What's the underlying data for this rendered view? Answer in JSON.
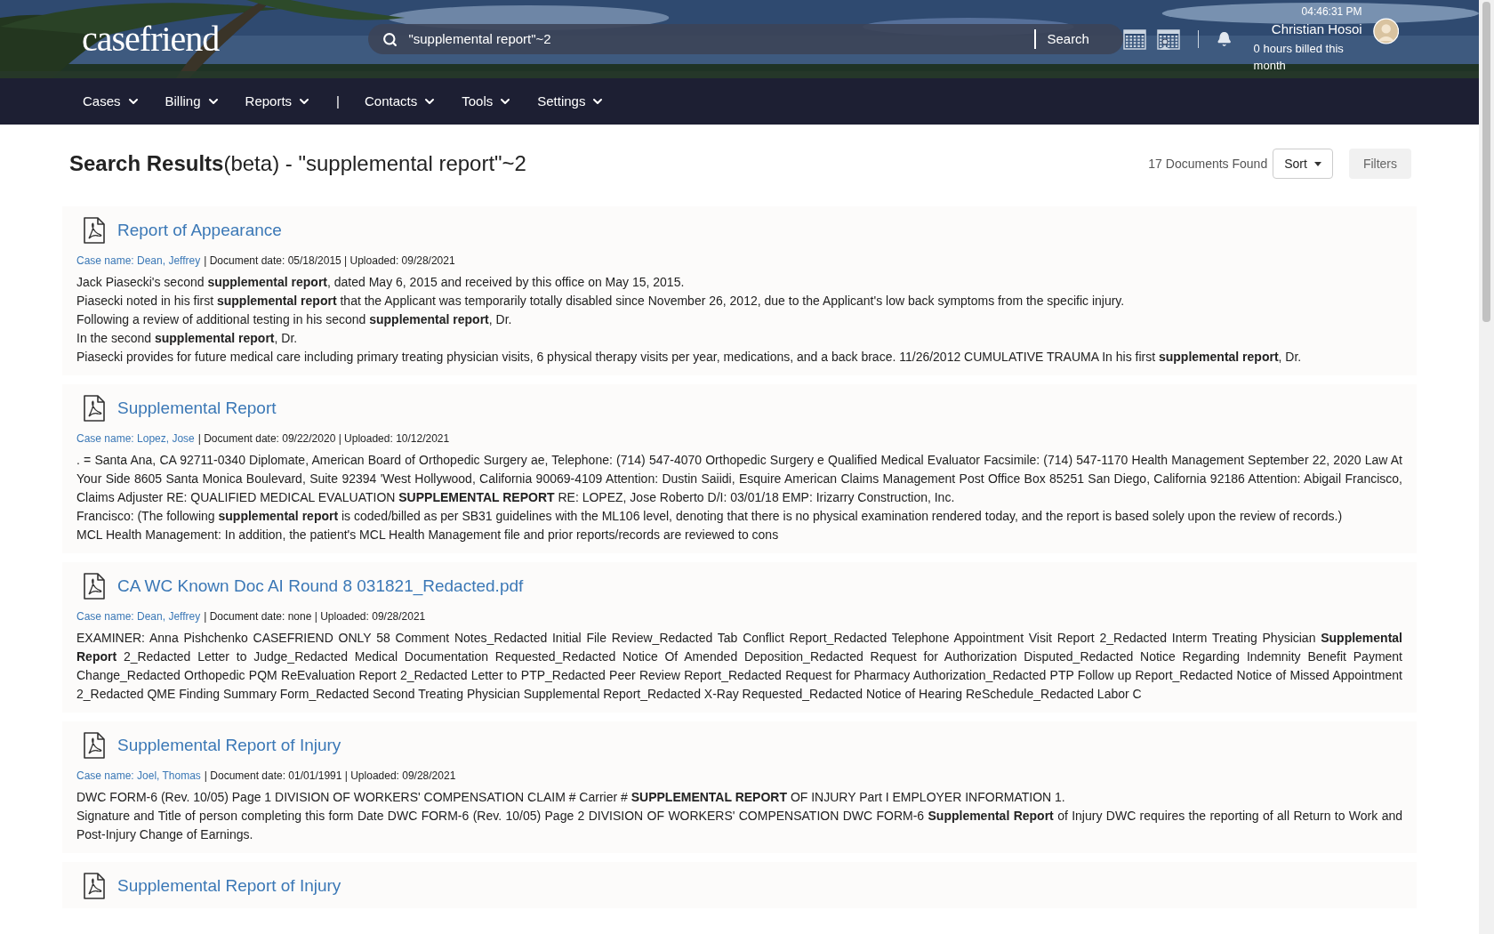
{
  "header": {
    "logo": "casefriend",
    "search": {
      "value": "\"supplemental report\"~2",
      "button": "Search"
    },
    "time": "04:46:31 PM",
    "user_name": "Christian Hosoi",
    "hours": "0 hours billed this month"
  },
  "nav": [
    {
      "kind": "menu",
      "label": "Cases"
    },
    {
      "kind": "menu",
      "label": "Billing"
    },
    {
      "kind": "menu",
      "label": "Reports"
    },
    {
      "kind": "separator",
      "label": "|"
    },
    {
      "kind": "menu",
      "label": "Contacts"
    },
    {
      "kind": "menu",
      "label": "Tools"
    },
    {
      "kind": "menu",
      "label": "Settings"
    }
  ],
  "results": {
    "title": "**Search Results**(beta) - \"supplemental report\"~2",
    "count": "17 Documents Found",
    "sort_button": "Sort",
    "filters_button": "Filters",
    "documents": [
      {
        "title": "Report of Appearance",
        "case_name": "Case name: Dean, Jeffrey",
        "meta": "| Document date: 05/18/2015 | Uploaded: 09/28/2021",
        "snippets": [
          "Jack Piasecki's second **supplemental report**, dated May 6, 2015 and received by this office on May 15, 2015.",
          "Piasecki noted in his first **supplemental report** that the Applicant was temporarily totally disabled since November 26, 2012, due to the Applicant's low back symptoms from the specific injury.",
          "Following a review of additional testing in his second **supplemental report**, Dr.",
          "In the second **supplemental report**, Dr.",
          "Piasecki provides for future medical care including primary treating physician visits, 6 physical therapy visits per year, medications, and a back brace. 11/26/2012 CUMULATIVE TRAUMA In his first **supplemental report**, Dr."
        ]
      },
      {
        "title": "Supplemental Report",
        "case_name": "Case name: Lopez, Jose",
        "meta": "| Document date: 09/22/2020 | Uploaded: 10/12/2021",
        "snippets": [
          ". = Santa Ana, CA 92711-0340 Diplomate, American Board of Orthopedic Surgery ae, Telephone: (714) 547-4070 Orthopedic Surgery e Qualified Medical Evaluator Facsimile: (714) 547-1170 Health Management September 22, 2020 Law At Your Side 8605 Santa Monica Boulevard, Suite 92394 'West Hollywood, California 90069-4109 Attention: Dustin Saiidi, Esquire American Claims Management Post Office Box 85251 San Diego, California 92186 Attention: Abigail Francisco, Claims Adjuster RE: QUALIFIED MEDICAL EVALUATION **SUPPLEMENTAL REPORT** RE: LOPEZ, Jose Roberto D/I: 03/01/18 EMP: Irizarry Construction, Inc.",
          "Francisco: (The following **supplemental report** is coded/billed as per SB31 guidelines with the ML106 level, denoting that there is no physical examination rendered today, and the report is based solely upon the review of records.)",
          "MCL Health Management: In addition, the patient's MCL Health Management file and prior reports/records are reviewed to cons"
        ]
      },
      {
        "title": "CA WC Known Doc AI Round 8 031821_Redacted.pdf",
        "case_name": "Case name: Dean, Jeffrey",
        "meta": "| Document date: none | Uploaded: 09/28/2021",
        "snippets": [
          "EXAMINER: Anna Pishchenko CASEFRIEND ONLY 58 Comment Notes_Redacted Initial File Review_Redacted Tab Conflict Report_Redacted Telephone Appointment Visit Report 2_Redacted Interm Treating Physician **Supplemental Report** 2_Redacted Letter to Judge_Redacted Medical Documentation Requested_Redacted Notice Of Amended Deposition_Redacted Request for Authorization Disputed_Redacted Notice Regarding Indemnity Benefit Payment Change_Redacted Orthopedic PQM ReEvaluation Report 2_Redacted Letter to PTP_Redacted Peer Review Report_Redacted Request for Pharmacy Authorization_Redacted PTP Follow up Report_Redacted Notice of Missed Appointment 2_Redacted QME Finding Summary Form_Redacted Second Treating Physician Supplemental Report_Redacted X-Ray Requested_Redacted Notice of Hearing ReSchedule_Redacted Labor C"
        ]
      },
      {
        "title": "Supplemental Report of Injury",
        "case_name": "Case name: Joel, Thomas",
        "meta": "| Document date: 01/01/1991 | Uploaded: 09/28/2021",
        "snippets": [
          "DWC FORM-6 (Rev. 10/05) Page 1 DIVISION OF WORKERS' COMPENSATION CLAIM # Carrier # **SUPPLEMENTAL REPORT** OF INJURY Part I EMPLOYER INFORMATION 1.",
          "Signature and Title of person completing this form Date DWC FORM-6 (Rev. 10/05) Page 2 DIVISION OF WORKERS' COMPENSATION DWC FORM-6 **Supplemental Report** of Injury DWC requires the reporting of all Return to Work and Post-Injury Change of Earnings."
        ]
      },
      {
        "title": "Supplemental Report of Injury"
      }
    ]
  }
}
